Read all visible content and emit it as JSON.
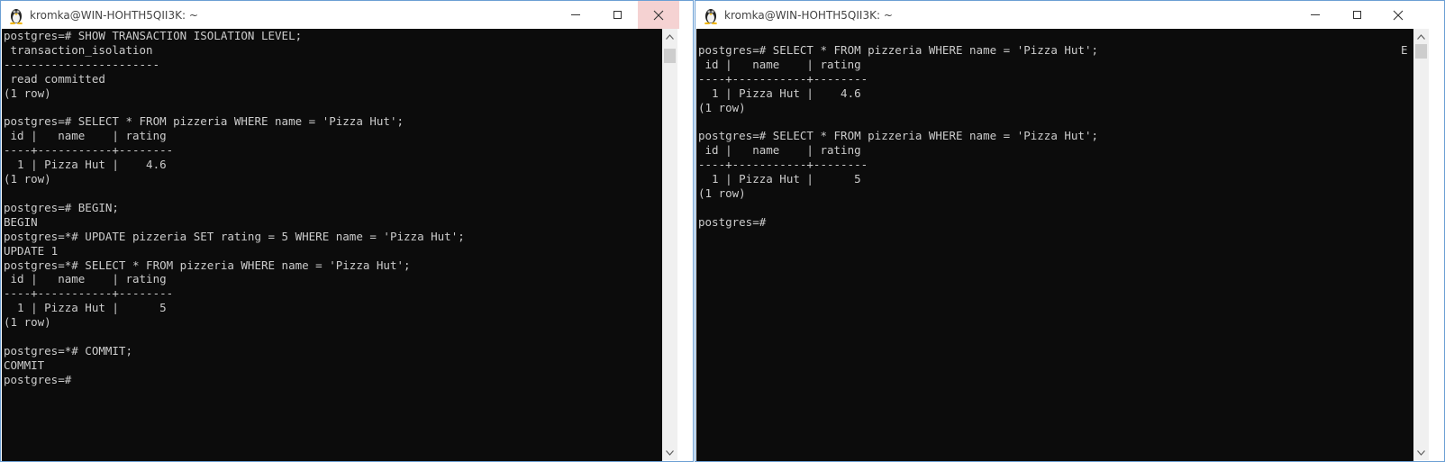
{
  "colors": {
    "console_bg": "#0c0c0c",
    "console_fg": "#cccccc",
    "titlebar_bg": "#ffffff",
    "close_hover_bg": "#f5d2d2",
    "window_border": "#6b9fd4"
  },
  "left_window": {
    "title": "kromka@WIN-HOHTH5QII3K: ~",
    "icon": "tux-linux-icon",
    "lines": [
      "postgres=# SHOW TRANSACTION ISOLATION LEVEL;",
      " transaction_isolation",
      "-----------------------",
      " read committed",
      "(1 row)",
      "",
      "postgres=# SELECT * FROM pizzeria WHERE name = 'Pizza Hut';",
      " id |   name    | rating",
      "----+-----------+--------",
      "  1 | Pizza Hut |    4.6",
      "(1 row)",
      "",
      "postgres=# BEGIN;",
      "BEGIN",
      "postgres=*# UPDATE pizzeria SET rating = 5 WHERE name = 'Pizza Hut';",
      "UPDATE 1",
      "postgres=*# SELECT * FROM pizzeria WHERE name = 'Pizza Hut';",
      " id |   name    | rating",
      "----+-----------+--------",
      "  1 | Pizza Hut |      5",
      "(1 row)",
      "",
      "postgres=*# COMMIT;",
      "COMMIT",
      "postgres=#"
    ]
  },
  "right_window": {
    "title": "kromka@WIN-HOHTH5QII3K: ~",
    "icon": "tux-linux-icon",
    "edge_char": "E",
    "lines": [
      "",
      "postgres=# SELECT * FROM pizzeria WHERE name = 'Pizza Hut';",
      " id |   name    | rating",
      "----+-----------+--------",
      "  1 | Pizza Hut |    4.6",
      "(1 row)",
      "",
      "postgres=# SELECT * FROM pizzeria WHERE name = 'Pizza Hut';",
      " id |   name    | rating",
      "----+-----------+--------",
      "  1 | Pizza Hut |      5",
      "(1 row)",
      "",
      "postgres=#"
    ]
  }
}
